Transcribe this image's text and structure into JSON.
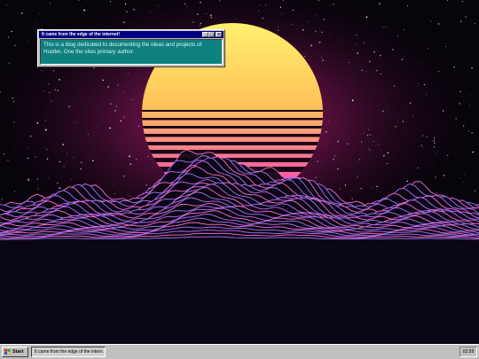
{
  "window": {
    "title": "It came from the edge of the internet!",
    "body": "This is a blog dedicated to documenting the ideas and projects of Hustler, One the sites primary author.",
    "minimize_glyph": "_",
    "maximize_glyph": "□",
    "close_glyph": "×"
  },
  "taskbar": {
    "start_label": "Start",
    "task_label": "It came from the edge of the intern...",
    "clock": "02:59"
  },
  "colors": {
    "titlebar": "#000080",
    "window_body": "#0e8080",
    "sun_top": "#fff06a",
    "sun_bottom": "#ff3fb0",
    "grid": "#d07bff"
  }
}
